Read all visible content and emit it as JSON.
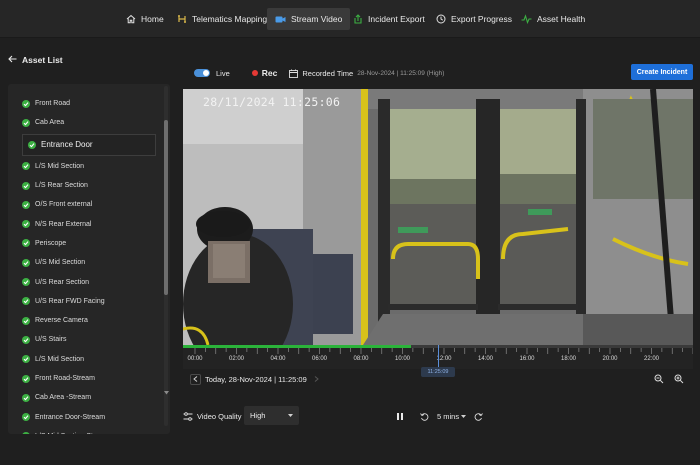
{
  "nav": {
    "items": [
      {
        "label": "Home",
        "icon": "home-icon",
        "active": false
      },
      {
        "label": "Telematics Mapping",
        "icon": "telematics-icon",
        "active": false
      },
      {
        "label": "Stream Video",
        "icon": "video-camera-icon",
        "active": true
      },
      {
        "label": "Incident Export",
        "icon": "export-icon",
        "active": false
      },
      {
        "label": "Export Progress",
        "icon": "progress-icon",
        "active": false
      },
      {
        "label": "Asset Health",
        "icon": "health-icon",
        "active": false
      }
    ]
  },
  "sidebar": {
    "title": "Asset List",
    "back_icon": "arrow-left-icon",
    "items": [
      {
        "label": "Front Road"
      },
      {
        "label": "Cab Area"
      },
      {
        "label": "Entrance Door",
        "selected": true
      },
      {
        "label": "L/S Mid Section"
      },
      {
        "label": "L/S Rear Section"
      },
      {
        "label": "O/S Front external"
      },
      {
        "label": "N/S Rear External"
      },
      {
        "label": "Periscope"
      },
      {
        "label": "U/S Mid Section"
      },
      {
        "label": "U/S Rear Section"
      },
      {
        "label": "U/S Rear FWD Facing"
      },
      {
        "label": "Reverse Camera"
      },
      {
        "label": "U/S Stairs"
      },
      {
        "label": "L/S Mid Section"
      },
      {
        "label": "Front Road-Stream"
      },
      {
        "label": "Cab Area -Stream"
      },
      {
        "label": "Entrance Door-Stream"
      },
      {
        "label": "L/S Mid Section-Stream"
      }
    ]
  },
  "status": {
    "live_label": "Live",
    "live_on": true,
    "rec_label": "Rec",
    "recorded_label": "Recorded Time",
    "recorded_value": "28-Nov-2024 | 11:25:09 (High)"
  },
  "create_incident_label": "Create Incident",
  "video": {
    "timestamp": "28/11/2024 11:25:06"
  },
  "timeline": {
    "labels": [
      "00:00",
      "02:00",
      "04:00",
      "06:00",
      "08:00",
      "10:00",
      "12:00",
      "14:00",
      "16:00",
      "18:00",
      "20:00",
      "22:00"
    ],
    "recorded_until_hour": 11.4,
    "cursor_label": "11:25:09"
  },
  "date_nav": {
    "label": "Today, 28-Nov-2024 | 11:25:09"
  },
  "quality": {
    "label": "Video Quality",
    "value": "High"
  },
  "playback": {
    "interval": "5 mins"
  },
  "colors": {
    "accent": "#1e6fd9",
    "recorded": "#2bb33a",
    "check": "#3cb043",
    "rec": "#e53935"
  }
}
